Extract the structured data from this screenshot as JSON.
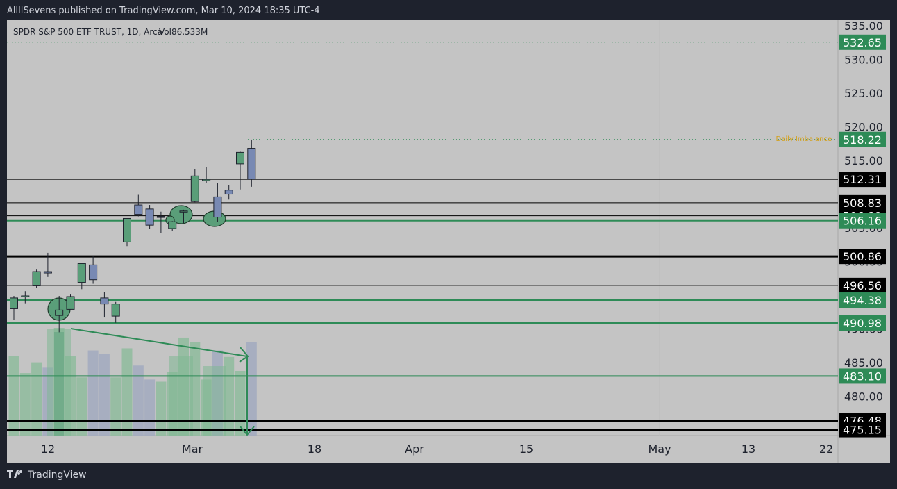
{
  "header": {
    "text": "AllllSevens published on TradingView.com, Mar 10, 2024 18:35 UTC-4"
  },
  "legend": {
    "symbol": "SPDR S&P 500 ETF TRUST, 1D, Arca",
    "volume": "Vol86.533M"
  },
  "annotation": {
    "text": "Daily Imbalance"
  },
  "footer": {
    "brand": "TradingView"
  },
  "colors": {
    "up": "#5a9e79",
    "down": "#7889b3",
    "green_line": "#2e8b57",
    "black_line": "#000000",
    "accent_text": "#d4a017"
  },
  "chart_data": {
    "type": "candlestick",
    "price_axis": {
      "range": [
        473.5,
        537.0
      ],
      "ticks": [
        "535.00",
        "530.00",
        "525.00",
        "520.00",
        "515.00",
        "505.00",
        "500.00",
        "495.00",
        "490.00",
        "485.00",
        "480.00",
        "475.00"
      ]
    },
    "time_axis": {
      "ticks": [
        "12",
        "Mar",
        "18",
        "Apr",
        "15",
        "May",
        "13",
        "22"
      ]
    },
    "candles": [
      {
        "o": 493.1,
        "h": 495.0,
        "l": 491.5,
        "c": 494.7
      },
      {
        "o": 494.9,
        "h": 495.7,
        "l": 493.9,
        "c": 495.0
      },
      {
        "o": 496.5,
        "h": 499.0,
        "l": 496.2,
        "c": 498.6
      },
      {
        "o": 498.6,
        "h": 501.4,
        "l": 497.8,
        "c": 498.4
      },
      {
        "o": 492.1,
        "h": 495.0,
        "l": 489.6,
        "c": 492.9
      },
      {
        "o": 493.0,
        "h": 495.3,
        "l": 493.0,
        "c": 494.9
      },
      {
        "o": 497.0,
        "h": 499.9,
        "l": 496.0,
        "c": 499.8
      },
      {
        "o": 499.6,
        "h": 500.9,
        "l": 496.8,
        "c": 497.4
      },
      {
        "o": 494.7,
        "h": 495.6,
        "l": 491.8,
        "c": 493.8
      },
      {
        "o": 492.0,
        "h": 494.1,
        "l": 491.0,
        "c": 493.8
      },
      {
        "o": 503.0,
        "h": 505.6,
        "l": 502.4,
        "c": 506.5
      },
      {
        "o": 508.5,
        "h": 510.0,
        "l": 506.8,
        "c": 507.1
      },
      {
        "o": 507.9,
        "h": 508.5,
        "l": 505.0,
        "c": 505.5
      },
      {
        "o": 506.8,
        "h": 507.5,
        "l": 504.3,
        "c": 506.8
      },
      {
        "o": 505.0,
        "h": 506.1,
        "l": 504.6,
        "c": 506.0
      },
      {
        "o": 507.6,
        "h": 507.8,
        "l": 505.8,
        "c": 507.6
      },
      {
        "o": 509.0,
        "h": 513.8,
        "l": 508.9,
        "c": 512.8
      },
      {
        "o": 512.1,
        "h": 514.1,
        "l": 511.8,
        "c": 512.3
      },
      {
        "o": 509.7,
        "h": 511.7,
        "l": 506.0,
        "c": 506.7
      },
      {
        "o": 510.7,
        "h": 511.4,
        "l": 509.3,
        "c": 510.1
      },
      {
        "o": 514.6,
        "h": 516.4,
        "l": 510.8,
        "c": 516.3
      },
      {
        "o": 516.9,
        "h": 518.2,
        "l": 511.2,
        "c": 512.3
      }
    ],
    "volume": [
      {
        "v": 0.74,
        "up": true
      },
      {
        "v": 0.58,
        "up": true
      },
      {
        "v": 0.68,
        "up": true
      },
      {
        "v": 0.63,
        "up": false
      },
      {
        "v": 1.0,
        "up": true
      },
      {
        "v": 0.74,
        "up": true
      },
      {
        "v": 0.54,
        "up": true
      },
      {
        "v": 0.79,
        "up": false
      },
      {
        "v": 0.76,
        "up": false
      },
      {
        "v": 0.54,
        "up": true
      },
      {
        "v": 0.81,
        "up": true
      },
      {
        "v": 0.65,
        "up": false
      },
      {
        "v": 0.52,
        "up": false
      },
      {
        "v": 0.5,
        "up": true
      },
      {
        "v": 0.59,
        "up": true
      },
      {
        "v": 0.91,
        "up": true
      },
      {
        "v": 0.87,
        "up": true
      },
      {
        "v": 0.52,
        "up": true
      },
      {
        "v": 0.79,
        "up": false
      },
      {
        "v": 0.73,
        "up": true
      },
      {
        "v": 0.6,
        "up": true
      },
      {
        "v": 0.87,
        "up": false
      }
    ],
    "levels": [
      {
        "price": 532.65,
        "label": "532.65",
        "color": "green",
        "style": "dotted"
      },
      {
        "price": 518.22,
        "label": "518.22",
        "color": "green",
        "style": "dotted"
      },
      {
        "price": 512.31,
        "label": "512.31",
        "color": "black",
        "style": "solid"
      },
      {
        "price": 508.83,
        "label": "508.83",
        "color": "black",
        "style": "solid"
      },
      {
        "price": 506.89,
        "label": "506.89",
        "color": "black",
        "style": "solid"
      },
      {
        "price": 506.16,
        "label": "506.16",
        "color": "green",
        "style": "solid"
      },
      {
        "price": 500.86,
        "label": "500.86",
        "color": "black",
        "style": "solid"
      },
      {
        "price": 496.56,
        "label": "496.56",
        "color": "black",
        "style": "solid"
      },
      {
        "price": 494.38,
        "label": "494.38",
        "color": "green",
        "style": "solid"
      },
      {
        "price": 490.98,
        "label": "490.98",
        "color": "green",
        "style": "solid"
      },
      {
        "price": 483.1,
        "label": "483.10",
        "color": "green",
        "style": "solid"
      },
      {
        "price": 476.48,
        "label": "476.48",
        "color": "black",
        "style": "solid"
      },
      {
        "price": 475.15,
        "label": "475.15",
        "color": "black",
        "style": "solid"
      }
    ]
  }
}
